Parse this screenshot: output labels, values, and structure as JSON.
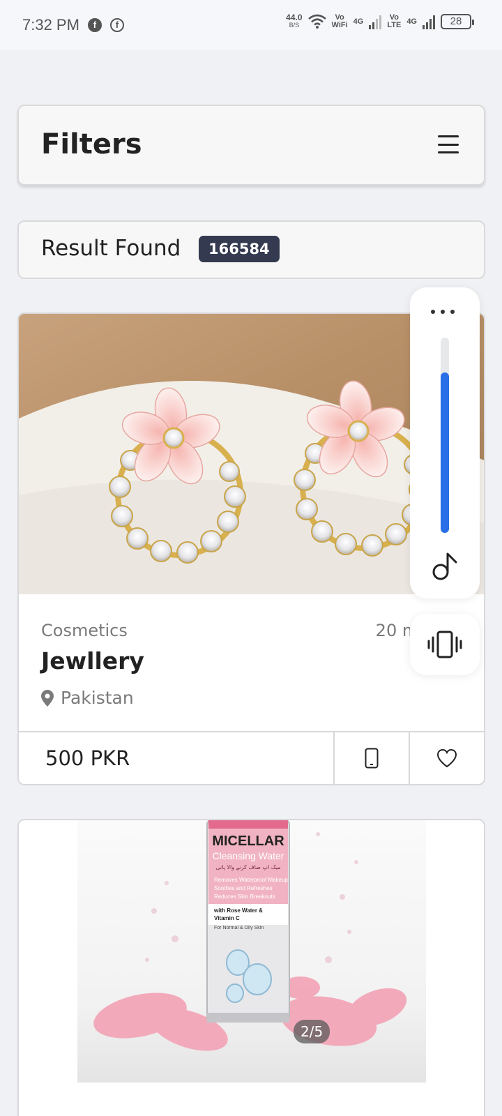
{
  "status_bar": {
    "time": "7:32 PM",
    "speed_value": "44.0",
    "speed_unit": "B/S",
    "vowifi_top": "Vo",
    "vowifi_bottom": "WiFi",
    "net1": "4G",
    "volte_top": "Vo",
    "volte_bottom": "LTE",
    "net2": "4G",
    "battery": "28"
  },
  "filters": {
    "title": "Filters",
    "menu_icon": "hamburger-menu-icon"
  },
  "results": {
    "label": "Result Found",
    "count": "166584"
  },
  "listings": [
    {
      "image": "earrings-photo",
      "category": "Cosmetics",
      "time": "20 minutes",
      "title": "Jewllery",
      "location": "Pakistan",
      "price": "500 PKR",
      "call_icon": "phone-icon",
      "fav_icon": "heart-icon"
    },
    {
      "image": "micellar-water-photo",
      "image_counter": "2/5",
      "product_brand": "MICELLAR",
      "product_name": "Cleansing Water",
      "product_urdu": "میک اپ صاف کرنے والا پانی",
      "product_benefits": [
        "Removes Waterproof Makeup",
        "Soothes and Refreshes",
        "Reduces Skin Breakouts"
      ],
      "product_ingredients_1": "with Rose Water &",
      "product_ingredients_2": "Vitamin C",
      "product_skin": "For Normal & Oily Skin"
    }
  ],
  "volume_panel": {
    "more_icon": "more-dots-icon",
    "level": 0.82,
    "accent": "#2a6fe8",
    "sound_icon": "music-note-icon",
    "vibrate_icon": "vibrate-icon"
  }
}
